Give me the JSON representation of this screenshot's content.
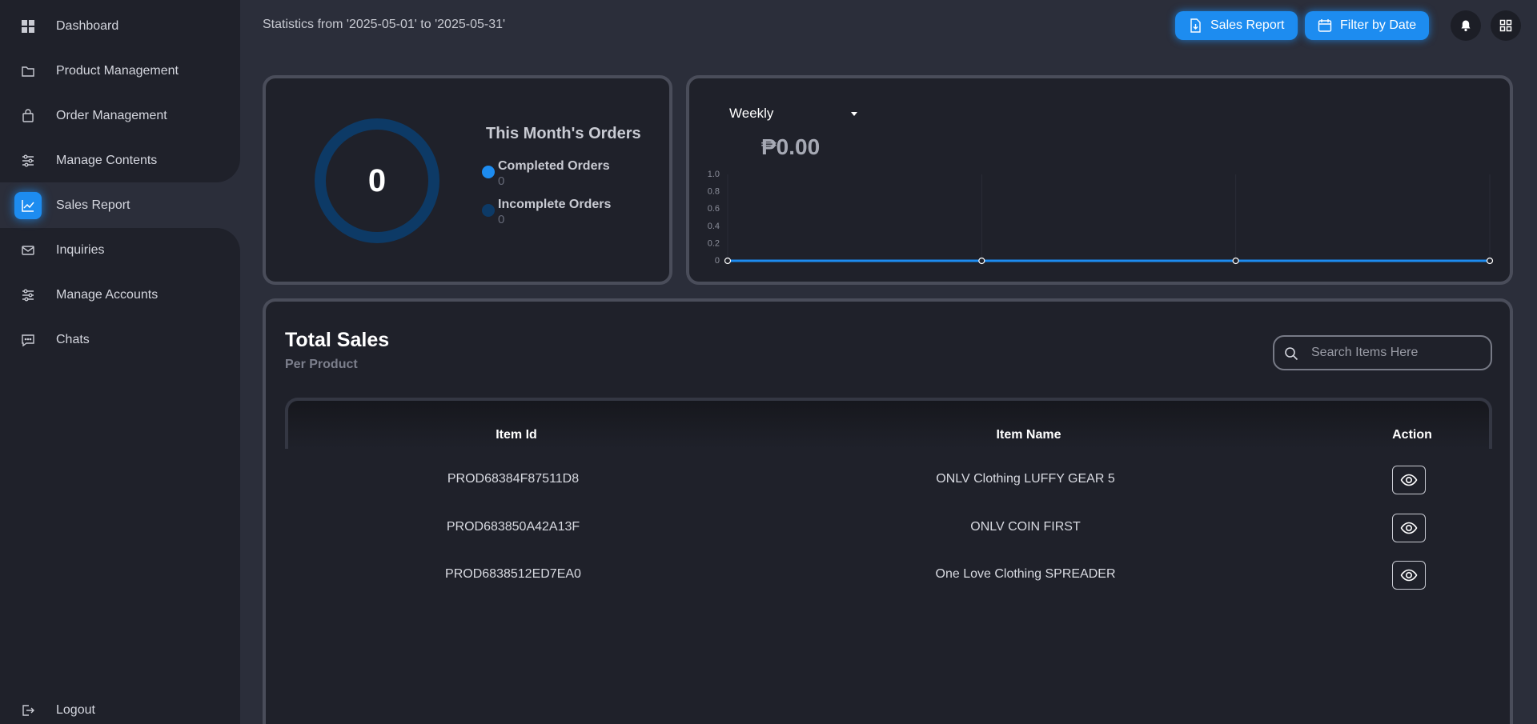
{
  "sidebar": {
    "items": [
      {
        "label": "Dashboard",
        "icon": "grid-icon"
      },
      {
        "label": "Product Management",
        "icon": "folder-icon"
      },
      {
        "label": "Order Management",
        "icon": "shopping-bag-icon"
      },
      {
        "label": "Manage Contents",
        "icon": "sliders-icon"
      },
      {
        "label": "Sales Report",
        "icon": "chart-icon",
        "active": true
      },
      {
        "label": "Inquiries",
        "icon": "mail-icon"
      },
      {
        "label": "Manage Accounts",
        "icon": "sliders-icon"
      },
      {
        "label": "Chats",
        "icon": "chat-icon"
      }
    ],
    "logout_label": "Logout"
  },
  "header": {
    "statistics_range": "Statistics from '2025-05-01' to '2025-05-31'",
    "sales_report_button": "Sales Report",
    "filter_button": "Filter by Date"
  },
  "orders_card": {
    "total": "0",
    "title": "This Month's Orders",
    "completed_label": "Completed Orders",
    "completed_value": "0",
    "incomplete_label": "Incomplete Orders",
    "incomplete_value": "0"
  },
  "sales_chart": {
    "period": "Weekly",
    "amount": "₱0.00"
  },
  "chart_data": {
    "type": "line",
    "title": "",
    "xlabel": "",
    "ylabel": "",
    "ylim": [
      0,
      1.0
    ],
    "y_ticks": [
      "0",
      "0.2",
      "0.4",
      "0.6",
      "0.8",
      "1.0"
    ],
    "series": [
      {
        "values": [
          0,
          0,
          0,
          0
        ]
      }
    ],
    "grid": true
  },
  "total_sales": {
    "title": "Total Sales",
    "subtitle": "Per Product",
    "search_placeholder": "Search Items Here",
    "columns": [
      "Item Id",
      "Item Name",
      "Action"
    ],
    "rows": [
      {
        "id": "PROD68384F87511D8",
        "name": "ONLV Clothing LUFFY GEAR 5"
      },
      {
        "id": "PROD683850A42A13F",
        "name": "ONLV COIN FIRST"
      },
      {
        "id": "PROD6838512ED7EA0",
        "name": "One Love Clothing SPREADER"
      }
    ]
  },
  "colors": {
    "accent": "#1d8cf0",
    "incomplete": "#0d3a66",
    "card_bg": "#1f212a",
    "page_bg": "#2b2e3a"
  }
}
